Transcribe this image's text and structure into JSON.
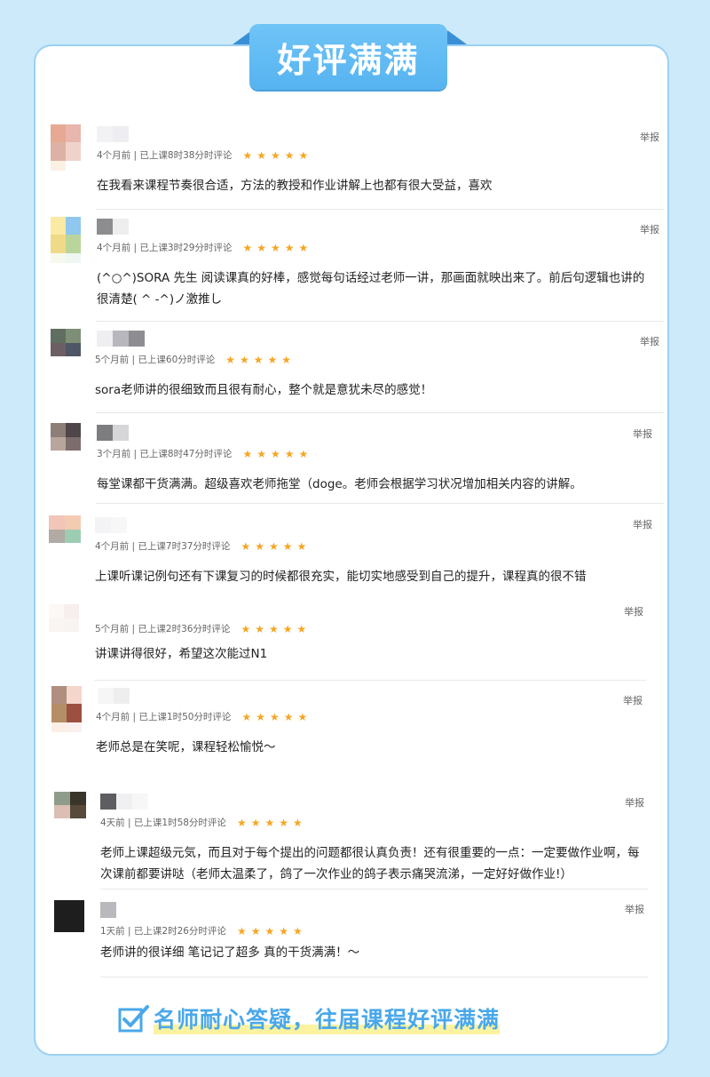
{
  "header": {
    "title": "好评满满"
  },
  "stars": "★★★★★",
  "report_label": "举报",
  "reviews": [
    {
      "meta": "4个月前 | 已上课8时38分时评论",
      "text": "在我看来课程节奏很合适，方法的教授和作业讲解上也都有很大受益，喜欢"
    },
    {
      "meta": "4个月前 | 已上课3时29分时评论",
      "text": "(^○^)SORA 先生 阅读课真的好棒，感觉每句话经过老师一讲，那画面就映出来了。前后句逻辑也讲的很清楚( ^ -^)ノ激推し"
    },
    {
      "meta": "5个月前 | 已上课60分时评论",
      "text": "sora老师讲的很细致而且很有耐心，整个就是意犹未尽的感觉！"
    },
    {
      "meta": "3个月前 | 已上课8时47分时评论",
      "text": "每堂课都干货满满。超级喜欢老师拖堂（doge。老师会根据学习状况增加相关内容的讲解。"
    },
    {
      "meta": "4个月前 | 已上课7时37分时评论",
      "text": "上课听课记例句还有下课复习的时候都很充实，能切实地感受到自己的提升，课程真的很不错"
    },
    {
      "meta": "5个月前 | 已上课2时36分时评论",
      "text": "讲课讲得很好，希望这次能过N1"
    },
    {
      "meta": "4个月前 | 已上课1时50分时评论",
      "text": "老师总是在笑呢，课程轻松愉悦～"
    },
    {
      "meta": "4天前 | 已上课1时58分时评论",
      "text": "老师上课超级元気，而且对于每个提出的问题都很认真负责！还有很重要的一点：一定要做作业啊，每次课前都要讲哒（老师太温柔了，鸽了一次作业的鸽子表示痛哭流涕，一定好好做作业!）"
    },
    {
      "meta": "1天前 | 已上课2时26分时评论",
      "text": "老师讲的很详细 笔记记了超多 真的干货满满！～"
    }
  ],
  "footer": {
    "text": "名师耐心答疑，往届课程好评满满"
  },
  "colors": {
    "accent": "#56b3f0",
    "star": "#f6a623",
    "background": "#cdeafb"
  }
}
